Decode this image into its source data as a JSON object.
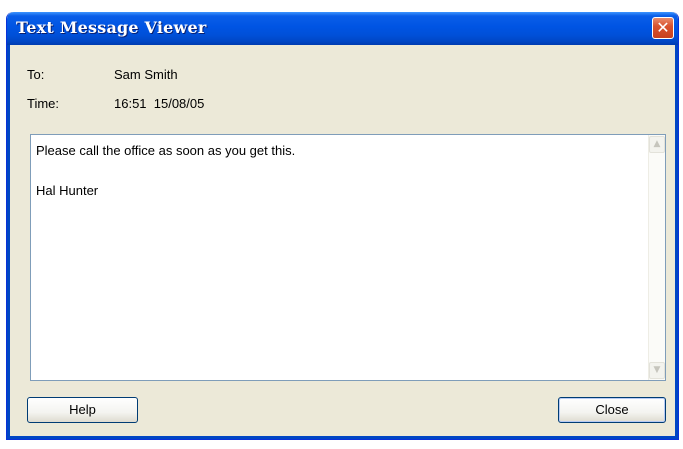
{
  "window": {
    "title": "Text Message Viewer",
    "close_glyph": "✕"
  },
  "fields": {
    "to_label": "To:",
    "to_value": "Sam Smith",
    "time_label": "Time:",
    "time_value": "16:51  15/08/05"
  },
  "message": {
    "body": "Please call the office as soon as you get this.\n\nHal Hunter"
  },
  "scrollbar": {
    "up_glyph": "▲",
    "down_glyph": "▼"
  },
  "buttons": {
    "help_label": "Help",
    "close_label": "Close"
  },
  "colors": {
    "titlebar": "#0054e3",
    "window_bg": "#ece9d8",
    "close_button": "#d9532f"
  }
}
